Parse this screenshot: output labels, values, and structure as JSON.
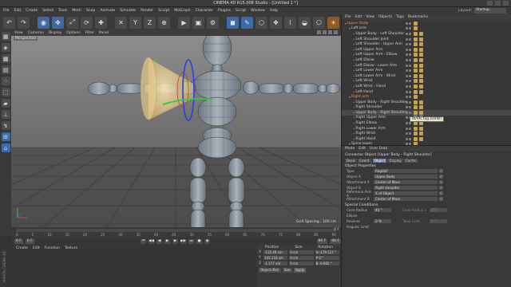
{
  "window": {
    "title": "CINEMA 4D R15.008 Studio - [Untitled 1 *]"
  },
  "menubar": {
    "items": [
      "File",
      "Edit",
      "Create",
      "Select",
      "Tools",
      "Mesh",
      "Snap",
      "Animate",
      "Simulate",
      "Render",
      "Sculpt",
      "MoGraph",
      "Character",
      "Plugins",
      "Script",
      "Window",
      "Help"
    ],
    "layout_label": "Layout:",
    "layout_value": "Startup"
  },
  "toolbar": {
    "buttons": [
      "undo",
      "redo",
      "live-select",
      "move",
      "scale",
      "rotate",
      "recent",
      "x-axis",
      "y-axis",
      "z-axis",
      "coordinate-system",
      "render-view",
      "render-settings",
      "picture-viewer",
      "cube",
      "pen",
      "subdivision",
      "array",
      "environment",
      "camera",
      "light"
    ]
  },
  "viewport": {
    "menu": [
      "View",
      "Cameras",
      "Display",
      "Options",
      "Filter",
      "Panel"
    ],
    "label": "Perspective",
    "grid_text": "Grid Spacing : 100 cm"
  },
  "timeline": {
    "ticks": [
      "0",
      "5",
      "10",
      "15",
      "20",
      "25",
      "30",
      "35",
      "40",
      "45",
      "50",
      "55",
      "60",
      "65",
      "70",
      "75",
      "80",
      "85",
      "90"
    ],
    "frame": "0 F"
  },
  "transport": {
    "start": "0 F",
    "current": "0 F",
    "end": "90 F",
    "end2": "90 F"
  },
  "materials": {
    "menu": [
      "Create",
      "Edit",
      "Function",
      "Texture"
    ],
    "logo": "MAXON CINEMA 4D"
  },
  "coords": {
    "headers": [
      "Position",
      "Size",
      "Rotation"
    ],
    "rows": [
      {
        "axis": "X",
        "pos": "-115.44 cm",
        "size": "0 cm",
        "rot": "H  -179.127 °"
      },
      {
        "axis": "Y",
        "pos": "145.116 cm",
        "size": "0 cm",
        "rot": "P  0 °"
      },
      {
        "axis": "Z",
        "pos": "-1.577 cm",
        "size": "0 cm",
        "rot": "B  -0.002 °"
      }
    ],
    "mode": "Object (Rel)",
    "size_mode": "Size",
    "apply": "Apply"
  },
  "objects": {
    "menu": [
      "File",
      "Edit",
      "View",
      "Objects",
      "Tags",
      "Bookmarks"
    ],
    "rows": [
      {
        "name": "Upper Body",
        "indent": 0,
        "orange": true
      },
      {
        "name": "Left arm",
        "indent": 1,
        "orange": false
      },
      {
        "name": "Upper Body - Left Shoulder",
        "indent": 2,
        "orange": false
      },
      {
        "name": "Left Shoulder Joint",
        "indent": 2,
        "orange": false
      },
      {
        "name": "Left Shoulder - Upper Arm",
        "indent": 2,
        "orange": false
      },
      {
        "name": "Left Upper Arm",
        "indent": 2,
        "orange": false
      },
      {
        "name": "Left Upper Arm - Elbow",
        "indent": 2,
        "orange": false
      },
      {
        "name": "Left Elbow",
        "indent": 2,
        "orange": false
      },
      {
        "name": "Left Elbow - Lower Arm",
        "indent": 2,
        "orange": false
      },
      {
        "name": "Left Lower Arm",
        "indent": 2,
        "orange": false
      },
      {
        "name": "Left Lower Arm - Wrist",
        "indent": 2,
        "orange": false
      },
      {
        "name": "Left Wrist",
        "indent": 2,
        "orange": false
      },
      {
        "name": "Left Wrist - Hand",
        "indent": 2,
        "orange": false
      },
      {
        "name": "Left Hand",
        "indent": 2,
        "orange": false
      },
      {
        "name": "Right arm",
        "indent": 1,
        "orange": true
      },
      {
        "name": "Upper Body - Right Shoulder",
        "indent": 2,
        "orange": false
      },
      {
        "name": "Right Shoulder",
        "indent": 2,
        "orange": false
      },
      {
        "name": "Upper Body - Right Shoulder",
        "indent": 2,
        "orange": false,
        "selected": true
      },
      {
        "name": "Right Upper Arm",
        "indent": 2,
        "orange": false
      },
      {
        "name": "Right Elbow",
        "indent": 2,
        "orange": false
      },
      {
        "name": "Right Lower Arm",
        "indent": 2,
        "orange": false
      },
      {
        "name": "Right Wrist",
        "indent": 2,
        "orange": false
      },
      {
        "name": "Right Hand",
        "indent": 2,
        "orange": false
      },
      {
        "name": "Spine lower",
        "indent": 1,
        "orange": false
      }
    ],
    "tooltip": "IK/VR Tag [UVW]"
  },
  "attributes": {
    "menu": [
      "Mode",
      "Edit",
      "User Data"
    ],
    "title": "Connector Object [Upper Body - Right Shoulder]",
    "tabs": [
      "Basic",
      "Coord.",
      "Object",
      "Display",
      "Cache"
    ],
    "active_tab": "Object",
    "section": "Object Properties",
    "props": [
      {
        "key": "Type",
        "value": "Ragdoll",
        "kind": "wide"
      },
      {
        "key": "Object A",
        "value": "Upper Body",
        "kind": "wide"
      },
      {
        "key": "Attachment A",
        "value": "Center of Mass",
        "kind": "wide"
      },
      {
        "key": "Object B",
        "value": "Right shoulder",
        "kind": "wide"
      },
      {
        "key": "Reference Axis A",
        "value": "X of Object",
        "kind": "wide"
      },
      {
        "key": "Attachment B",
        "value": "Center of Mass",
        "kind": "wide"
      }
    ],
    "section2": "Special Conditions",
    "props2": [
      {
        "key": "Cone Radius",
        "value": "45 °",
        "extra": "Cone Radius 2",
        "extra_val": "45 °"
      },
      {
        "key": "Ellipse",
        "value": "",
        "extra": "",
        "extra_val": ""
      },
      {
        "key": "Reverse",
        "value": "0 %",
        "extra": "Twist Limit",
        "extra_val": "0 °"
      },
      {
        "key": "Angular Limit",
        "value": "",
        "extra": "",
        "extra_val": ""
      }
    ]
  }
}
